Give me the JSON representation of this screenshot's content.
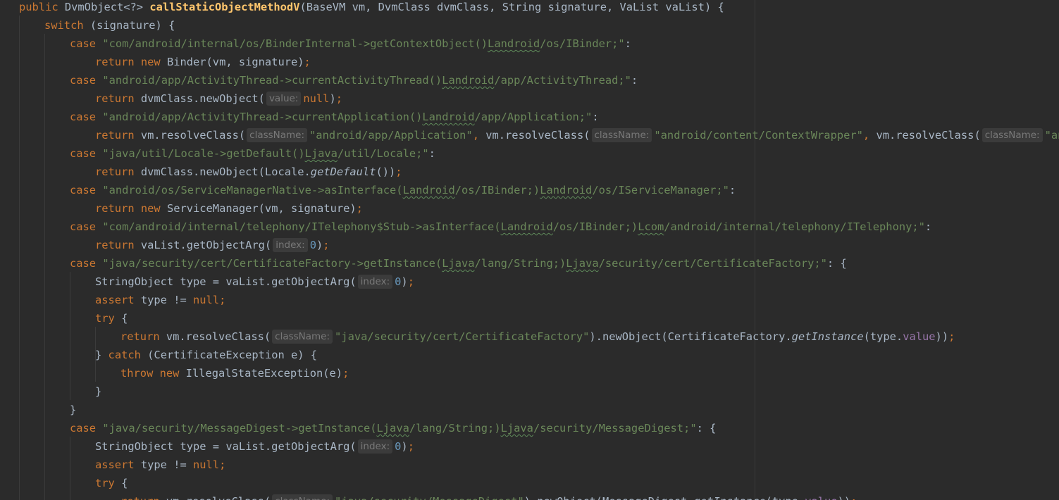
{
  "editor": {
    "colors": {
      "background": "#2b2b2b",
      "keyword": "#cc7832",
      "method_declaration": "#ffc66d",
      "string": "#6a8759",
      "number": "#6897bb",
      "field": "#9876aa",
      "default_text": "#a9b7c6",
      "param_hint_bg": "#3b3b3b",
      "param_hint_text": "#787878"
    },
    "lines": [
      {
        "indent": 0,
        "tokens": [
          {
            "t": "kw",
            "v": "public"
          },
          {
            "v": " DvmObject<?> "
          },
          {
            "t": "fn",
            "v": "callStaticObjectMethodV"
          },
          {
            "v": "(BaseVM vm, DvmClass dvmClass, String signature, VaList vaList) {"
          }
        ]
      },
      {
        "indent": 1,
        "tokens": [
          {
            "t": "kw",
            "v": "switch"
          },
          {
            "v": " (signature) {"
          }
        ]
      },
      {
        "indent": 2,
        "tokens": [
          {
            "t": "kw",
            "v": "case "
          },
          {
            "t": "str",
            "v": "\"com/android/internal/os/BinderInternal->getContextObject()"
          },
          {
            "t": "str",
            "sq": true,
            "v": "Landroid"
          },
          {
            "t": "str",
            "v": "/os/IBinder;\""
          },
          {
            "v": ":"
          }
        ]
      },
      {
        "indent": 3,
        "tokens": [
          {
            "t": "kw",
            "v": "return new "
          },
          {
            "v": "Binder(vm, signature)"
          },
          {
            "t": "kw",
            "v": ";"
          }
        ]
      },
      {
        "indent": 2,
        "tokens": [
          {
            "t": "kw",
            "v": "case "
          },
          {
            "t": "str",
            "v": "\"android/app/ActivityThread->currentActivityThread()"
          },
          {
            "t": "str",
            "sq": true,
            "v": "Landroid"
          },
          {
            "t": "str",
            "v": "/app/ActivityThread;\""
          },
          {
            "v": ":"
          }
        ]
      },
      {
        "indent": 3,
        "tokens": [
          {
            "t": "kw",
            "v": "return "
          },
          {
            "v": "dvmClass.newObject("
          },
          {
            "t": "hint",
            "v": "value:"
          },
          {
            "t": "kw",
            "v": "null"
          },
          {
            "v": ")"
          },
          {
            "t": "kw",
            "v": ";"
          }
        ]
      },
      {
        "indent": 2,
        "tokens": [
          {
            "t": "kw",
            "v": "case "
          },
          {
            "t": "str",
            "v": "\"android/app/ActivityThread->currentApplication()"
          },
          {
            "t": "str",
            "sq": true,
            "v": "Landroid"
          },
          {
            "t": "str",
            "v": "/app/Application;\""
          },
          {
            "v": ":"
          }
        ]
      },
      {
        "indent": 3,
        "tokens": [
          {
            "t": "kw",
            "v": "return "
          },
          {
            "v": "vm.resolveClass("
          },
          {
            "t": "hint",
            "v": "className:"
          },
          {
            "t": "str",
            "v": "\"android/app/Application\""
          },
          {
            "t": "kw",
            "v": ", "
          },
          {
            "v": "vm.resolveClass("
          },
          {
            "t": "hint",
            "v": "className:"
          },
          {
            "t": "str",
            "v": "\"android/content/ContextWrapper\""
          },
          {
            "t": "kw",
            "v": ", "
          },
          {
            "v": "vm.resolveClass("
          },
          {
            "t": "hint",
            "v": "className:"
          },
          {
            "t": "str",
            "v": "\"androi"
          }
        ]
      },
      {
        "indent": 2,
        "tokens": [
          {
            "t": "kw",
            "v": "case "
          },
          {
            "t": "str",
            "v": "\"java/util/Locale->getDefault()"
          },
          {
            "t": "str",
            "sq": true,
            "v": "Ljava"
          },
          {
            "t": "str",
            "v": "/util/Locale;\""
          },
          {
            "v": ":"
          }
        ]
      },
      {
        "indent": 3,
        "tokens": [
          {
            "t": "kw",
            "v": "return "
          },
          {
            "v": "dvmClass.newObject(Locale."
          },
          {
            "t": "static",
            "v": "getDefault"
          },
          {
            "v": "())"
          },
          {
            "t": "kw",
            "v": ";"
          }
        ]
      },
      {
        "indent": 2,
        "tokens": [
          {
            "t": "kw",
            "v": "case "
          },
          {
            "t": "str",
            "v": "\"android/os/ServiceManagerNative->asInterface("
          },
          {
            "t": "str",
            "sq": true,
            "v": "Landroid"
          },
          {
            "t": "str",
            "v": "/os/IBinder;)"
          },
          {
            "t": "str",
            "sq": true,
            "v": "Landroid"
          },
          {
            "t": "str",
            "v": "/os/IServiceManager;\""
          },
          {
            "v": ":"
          }
        ]
      },
      {
        "indent": 3,
        "tokens": [
          {
            "t": "kw",
            "v": "return new "
          },
          {
            "v": "ServiceManager(vm, signature)"
          },
          {
            "t": "kw",
            "v": ";"
          }
        ]
      },
      {
        "indent": 2,
        "tokens": [
          {
            "t": "kw",
            "v": "case "
          },
          {
            "t": "str",
            "v": "\"com/android/internal/telephony/ITelephony$Stub->asInterface("
          },
          {
            "t": "str",
            "sq": true,
            "v": "Landroid"
          },
          {
            "t": "str",
            "v": "/os/IBinder;)"
          },
          {
            "t": "str",
            "sq": true,
            "v": "Lcom"
          },
          {
            "t": "str",
            "v": "/android/internal/telephony/ITelephony;\""
          },
          {
            "v": ":"
          }
        ]
      },
      {
        "indent": 3,
        "tokens": [
          {
            "t": "kw",
            "v": "return "
          },
          {
            "v": "vaList.getObjectArg("
          },
          {
            "t": "hint",
            "v": "index:"
          },
          {
            "t": "num",
            "v": "0"
          },
          {
            "v": ")"
          },
          {
            "t": "kw",
            "v": ";"
          }
        ]
      },
      {
        "indent": 2,
        "tokens": [
          {
            "t": "kw",
            "v": "case "
          },
          {
            "t": "str",
            "v": "\"java/security/cert/CertificateFactory->getInstance("
          },
          {
            "t": "str",
            "sq": true,
            "v": "Ljava"
          },
          {
            "t": "str",
            "v": "/lang/String;)"
          },
          {
            "t": "str",
            "sq": true,
            "v": "Ljava"
          },
          {
            "t": "str",
            "v": "/security/cert/CertificateFactory;\""
          },
          {
            "v": ": {"
          }
        ]
      },
      {
        "indent": 3,
        "tokens": [
          {
            "v": "StringObject type = vaList.getObjectArg("
          },
          {
            "t": "hint",
            "v": "index:"
          },
          {
            "t": "num",
            "v": "0"
          },
          {
            "v": ")"
          },
          {
            "t": "kw",
            "v": ";"
          }
        ]
      },
      {
        "indent": 3,
        "tokens": [
          {
            "t": "kw",
            "v": "assert "
          },
          {
            "v": "type != "
          },
          {
            "t": "kw",
            "v": "null;"
          }
        ]
      },
      {
        "indent": 3,
        "tokens": [
          {
            "t": "kw",
            "v": "try "
          },
          {
            "v": "{"
          }
        ]
      },
      {
        "indent": 4,
        "tokens": [
          {
            "t": "kw",
            "v": "return "
          },
          {
            "v": "vm.resolveClass("
          },
          {
            "t": "hint",
            "v": "className:"
          },
          {
            "t": "str",
            "v": "\"java/security/cert/CertificateFactory\""
          },
          {
            "v": ").newObject(CertificateFactory."
          },
          {
            "t": "static",
            "v": "getInstance"
          },
          {
            "v": "(type."
          },
          {
            "t": "field",
            "v": "value"
          },
          {
            "v": "))"
          },
          {
            "t": "kw",
            "v": ";"
          }
        ]
      },
      {
        "indent": 3,
        "tokens": [
          {
            "v": "} "
          },
          {
            "t": "kw",
            "v": "catch "
          },
          {
            "v": "(CertificateException e) {"
          }
        ]
      },
      {
        "indent": 4,
        "tokens": [
          {
            "t": "kw",
            "v": "throw new "
          },
          {
            "v": "IllegalStateException(e)"
          },
          {
            "t": "kw",
            "v": ";"
          }
        ]
      },
      {
        "indent": 3,
        "tokens": [
          {
            "v": "}"
          }
        ]
      },
      {
        "indent": 2,
        "tokens": [
          {
            "v": "}"
          }
        ]
      },
      {
        "indent": 2,
        "tokens": [
          {
            "t": "kw",
            "v": "case "
          },
          {
            "t": "str",
            "v": "\"java/security/MessageDigest->getInstance("
          },
          {
            "t": "str",
            "sq": true,
            "v": "Ljava"
          },
          {
            "t": "str",
            "v": "/lang/String;)"
          },
          {
            "t": "str",
            "sq": true,
            "v": "Ljava"
          },
          {
            "t": "str",
            "v": "/security/MessageDigest;\""
          },
          {
            "v": ": {"
          }
        ]
      },
      {
        "indent": 3,
        "tokens": [
          {
            "v": "StringObject type = vaList.getObjectArg("
          },
          {
            "t": "hint",
            "v": "index:"
          },
          {
            "t": "num",
            "v": "0"
          },
          {
            "v": ")"
          },
          {
            "t": "kw",
            "v": ";"
          }
        ]
      },
      {
        "indent": 3,
        "tokens": [
          {
            "t": "kw",
            "v": "assert "
          },
          {
            "v": "type != "
          },
          {
            "t": "kw",
            "v": "null;"
          }
        ]
      },
      {
        "indent": 3,
        "tokens": [
          {
            "t": "kw",
            "v": "try "
          },
          {
            "v": "{"
          }
        ]
      },
      {
        "indent": 4,
        "tokens": [
          {
            "t": "kw",
            "v": "return "
          },
          {
            "v": "vm.resolveClass("
          },
          {
            "t": "hint",
            "v": "className:"
          },
          {
            "t": "str",
            "v": "\"java/security/MessageDigest\""
          },
          {
            "v": ").newObject(MessageDigest."
          },
          {
            "t": "static",
            "v": "getInstance"
          },
          {
            "v": "(type."
          },
          {
            "t": "field",
            "v": "value"
          },
          {
            "v": "))"
          },
          {
            "t": "kw",
            "v": ";"
          }
        ]
      }
    ]
  }
}
